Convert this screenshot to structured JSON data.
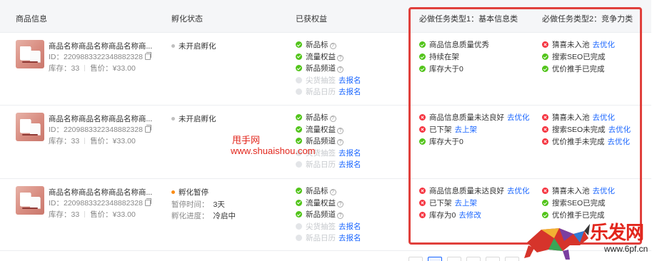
{
  "header": {
    "col_product": "商品信息",
    "col_status": "孵化状态",
    "col_benefits": "已获权益",
    "col_task1": "必做任务类型1：基本信息类",
    "col_task2": "必做任务类型2：竞争力类"
  },
  "rows": [
    {
      "product": {
        "name": "商品名称商品名称商品名称商...",
        "id": "ID：2209883322348882328",
        "stock": "库存：33",
        "price": "售价：¥33.00"
      },
      "status": {
        "label": "未开启孵化",
        "dot_color": "#bfbfbf"
      },
      "benefits": [
        {
          "label": "新品标",
          "state": "ok",
          "help": true
        },
        {
          "label": "流量权益",
          "state": "ok",
          "help": true
        },
        {
          "label": "新品频道",
          "state": "ok",
          "help": true
        },
        {
          "label": "尖货抽签",
          "state": "off",
          "link": "去报名"
        },
        {
          "label": "新品日历",
          "state": "off",
          "link": "去报名"
        }
      ],
      "task1": [
        {
          "label": "商品信息质量优秀",
          "state": "ok"
        },
        {
          "label": "持续在架",
          "state": "ok"
        },
        {
          "label": "库存大于0",
          "state": "ok"
        }
      ],
      "task2": [
        {
          "label": "猜喜未入池",
          "state": "err",
          "link": "去优化"
        },
        {
          "label": "搜索SEO已完成",
          "state": "ok"
        },
        {
          "label": "优价推手已完成",
          "state": "ok"
        }
      ]
    },
    {
      "product": {
        "name": "商品名称商品名称商品名称商...",
        "id": "ID：2209883322348882328",
        "stock": "库存：33",
        "price": "售价：¥33.00"
      },
      "status": {
        "label": "未开启孵化",
        "dot_color": "#bfbfbf"
      },
      "benefits": [
        {
          "label": "新品标",
          "state": "ok",
          "help": true
        },
        {
          "label": "流量权益",
          "state": "ok",
          "help": true
        },
        {
          "label": "新品频道",
          "state": "ok",
          "help": true
        },
        {
          "label": "尖货抽签",
          "state": "off",
          "link": "去报名"
        },
        {
          "label": "新品日历",
          "state": "off",
          "link": "去报名"
        }
      ],
      "task1": [
        {
          "label": "商品信息质量未达良好",
          "state": "err",
          "link": "去优化"
        },
        {
          "label": "已下架",
          "state": "err",
          "link": "去上架"
        },
        {
          "label": "库存大于0",
          "state": "ok"
        }
      ],
      "task2": [
        {
          "label": "猜喜未入池",
          "state": "err",
          "link": "去优化"
        },
        {
          "label": "搜索SEO未完成",
          "state": "err",
          "link": "去优化"
        },
        {
          "label": "优价推手未完成",
          "state": "err",
          "link": "去优化"
        }
      ]
    },
    {
      "product": {
        "name": "商品名称商品名称商品名称商...",
        "id": "ID：2209883322348882328",
        "stock": "库存：33",
        "price": "售价：¥33.00"
      },
      "status": {
        "label": "孵化暂停",
        "dot_color": "#fa8c16",
        "pause_label": "暂停时间：",
        "pause_value": "3天",
        "progress_label": "孵化进度：",
        "progress_value": "冷启中"
      },
      "benefits": [
        {
          "label": "新品标",
          "state": "ok",
          "help": true
        },
        {
          "label": "流量权益",
          "state": "ok",
          "help": true
        },
        {
          "label": "新品频道",
          "state": "ok",
          "help": true
        },
        {
          "label": "尖货抽签",
          "state": "off",
          "link": "去报名"
        },
        {
          "label": "新品日历",
          "state": "off",
          "link": "去报名"
        }
      ],
      "task1": [
        {
          "label": "商品信息质量未达良好",
          "state": "err",
          "link": "去优化"
        },
        {
          "label": "已下架",
          "state": "err",
          "link": "去上架"
        },
        {
          "label": "库存为0",
          "state": "err",
          "link": "去修改"
        }
      ],
      "task2": [
        {
          "label": "猜喜未入池",
          "state": "err",
          "link": "去优化"
        },
        {
          "label": "搜索SEO已完成",
          "state": "ok"
        },
        {
          "label": "优价推手已完成",
          "state": "ok"
        }
      ]
    }
  ],
  "watermark": {
    "line1": "甩手网",
    "line2": "www.shuaishou.com"
  },
  "logo": {
    "text": "乐发网",
    "url": "www.6pf.cn"
  },
  "colors": {
    "accent": "#1a66ff",
    "ok": "#52c41a",
    "error": "#f5333f",
    "highlight_box": "#e0403c"
  }
}
